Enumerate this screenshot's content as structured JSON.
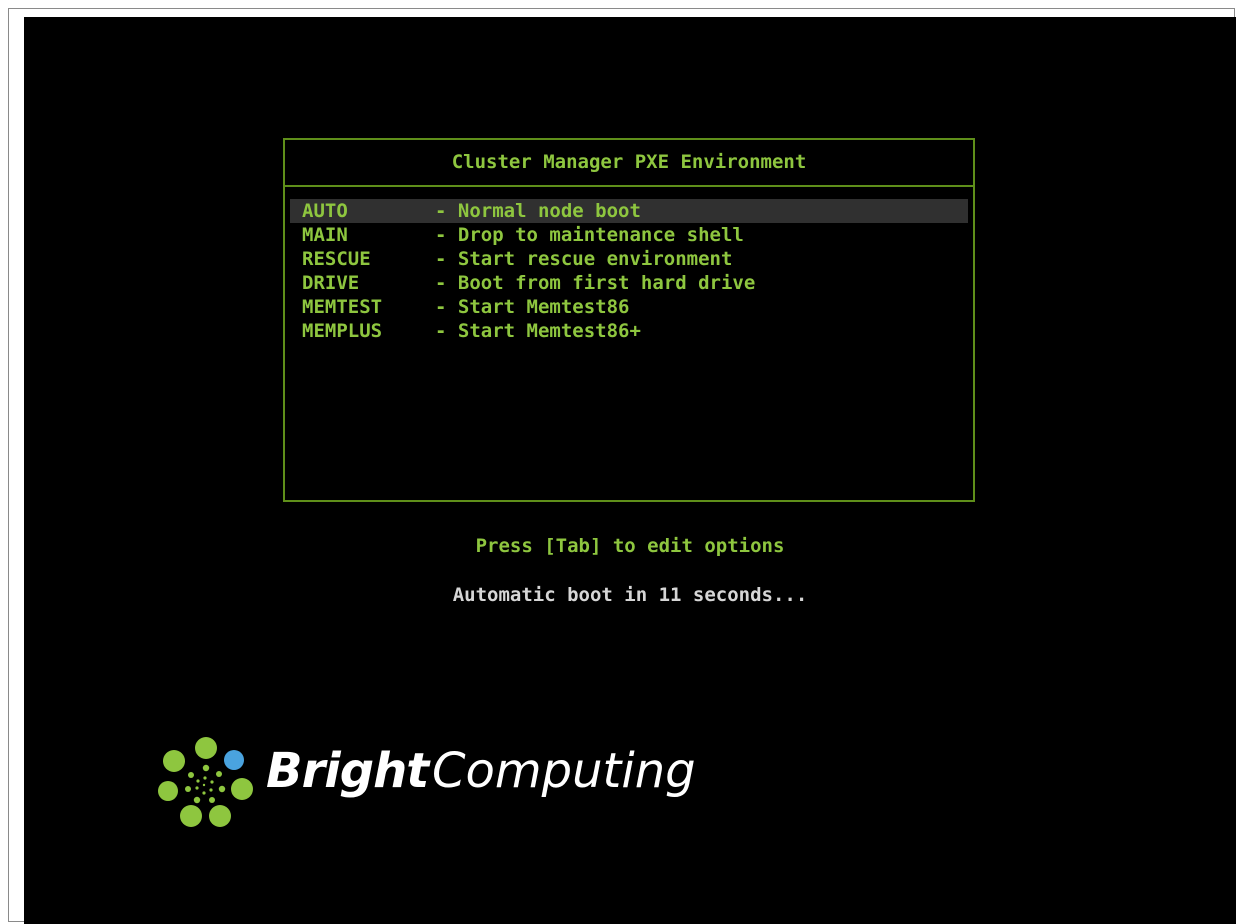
{
  "menu": {
    "title": "Cluster Manager PXE Environment",
    "selected_index": 0,
    "items": [
      {
        "key": "AUTO",
        "desc": "- Normal node boot"
      },
      {
        "key": "MAIN",
        "desc": "- Drop to maintenance shell"
      },
      {
        "key": "RESCUE",
        "desc": "- Start rescue environment"
      },
      {
        "key": "DRIVE",
        "desc": "- Boot from first hard drive"
      },
      {
        "key": "MEMTEST",
        "desc": "- Start Memtest86"
      },
      {
        "key": "MEMPLUS",
        "desc": "- Start Memtest86+"
      }
    ]
  },
  "hint": "Press [Tab] to edit options",
  "countdown": "Automatic boot in 11 seconds...",
  "logo": {
    "word_bold": "Bright",
    "word_light": "Computing",
    "icon": "bright-computing-dots-icon"
  },
  "colors": {
    "background": "#000000",
    "accent_green": "#8ec63f",
    "border_green": "#5f8f1a",
    "selection_bg": "#303030",
    "countdown_text": "#d6d6d6",
    "logo_blue": "#4aa3df"
  }
}
